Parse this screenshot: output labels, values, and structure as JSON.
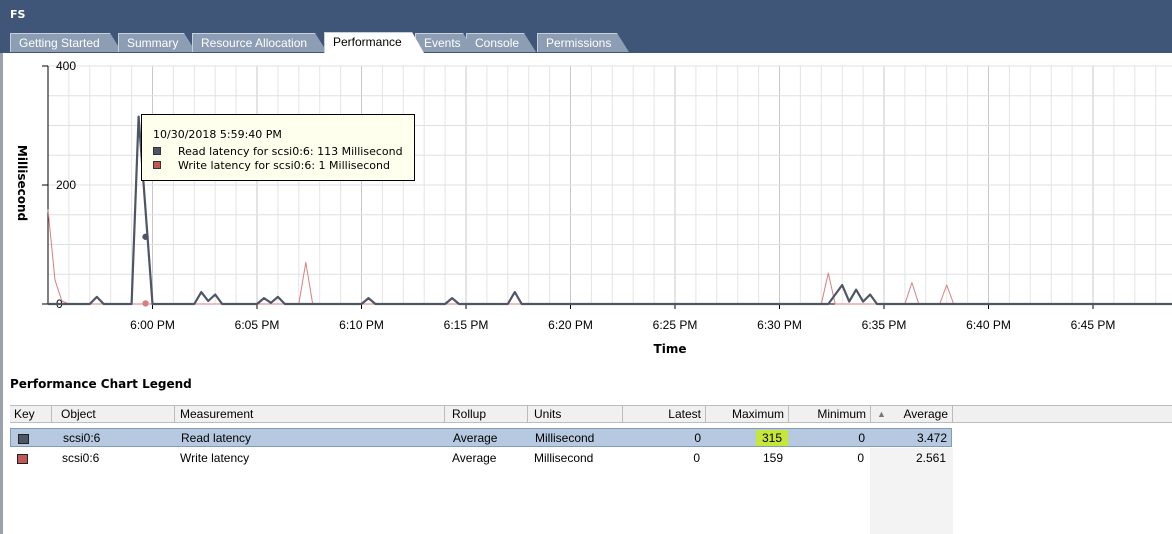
{
  "window": {
    "title": "FS"
  },
  "tabs": [
    {
      "label": "Getting Started",
      "active": false
    },
    {
      "label": "Summary",
      "active": false
    },
    {
      "label": "Resource Allocation",
      "active": false
    },
    {
      "label": "Performance",
      "active": true
    },
    {
      "label": "Events",
      "active": false
    },
    {
      "label": "Console",
      "active": false
    },
    {
      "label": "Permissions",
      "active": false
    }
  ],
  "chart_data": {
    "type": "line",
    "xlabel": "Time",
    "ylabel": "Millisecond",
    "ylim": [
      0,
      400
    ],
    "y_ticks": [
      "400",
      "200",
      "0"
    ],
    "x_tick_labels": [
      "6:00 PM",
      "6:05 PM",
      "6:10 PM",
      "6:15 PM",
      "6:20 PM",
      "6:25 PM",
      "6:30 PM",
      "6:35 PM",
      "6:40 PM",
      "6:45 PM",
      "6"
    ],
    "grid": true,
    "series": [
      {
        "name": "Read latency",
        "color": "#4e5566",
        "x": [
          "5:55 PM",
          "5:57 PM",
          "5:57:20 PM",
          "5:57:40 PM",
          "5:59 PM",
          "5:59:20 PM",
          "6:00 PM",
          "6:02 PM",
          "6:02:20 PM",
          "6:02:40 PM",
          "6:03 PM",
          "6:03:20 PM",
          "6:05 PM",
          "6:05:20 PM",
          "6:05:40 PM",
          "6:06 PM",
          "6:06:20 PM",
          "6:10 PM",
          "6:10:20 PM",
          "6:10:40 PM",
          "6:14 PM",
          "6:14:20 PM",
          "6:14:40 PM",
          "6:17 PM",
          "6:17:20 PM",
          "6:17:40 PM",
          "6:32:20 PM",
          "6:33 PM",
          "6:33:20 PM",
          "6:33:40 PM",
          "6:34 PM",
          "6:34:20 PM",
          "6:34:40 PM",
          "6:35 PM",
          "6:50 PM"
        ],
        "values": [
          0,
          0,
          12,
          0,
          0,
          315,
          0,
          0,
          20,
          5,
          16,
          0,
          0,
          10,
          2,
          12,
          0,
          0,
          10,
          0,
          0,
          10,
          0,
          0,
          20,
          0,
          0,
          32,
          4,
          24,
          4,
          16,
          0,
          0,
          0
        ]
      },
      {
        "name": "Write latency",
        "color": "#d67f7f",
        "x": [
          "5:55 PM",
          "5:55:20 PM",
          "5:55:40 PM",
          "5:56 PM",
          "5:59 PM",
          "6:07 PM",
          "6:07:20 PM",
          "6:07:40 PM",
          "6:32 PM",
          "6:32:20 PM",
          "6:32:40 PM",
          "6:36 PM",
          "6:36:20 PM",
          "6:36:40 PM",
          "6:37:40 PM",
          "6:38 PM",
          "6:38:20 PM",
          "6:50 PM"
        ],
        "values": [
          159,
          40,
          5,
          0,
          0,
          0,
          70,
          0,
          0,
          52,
          0,
          0,
          36,
          0,
          0,
          32,
          0,
          0
        ]
      }
    ],
    "tooltip": {
      "time": "10/30/2018 5:59:40 PM",
      "read": "Read latency for scsi0:6: 113 Millisecond",
      "write": "Write latency for scsi0:6: 1 Millisecond",
      "read_value": 113,
      "write_value": 1
    }
  },
  "legend": {
    "heading": "Performance Chart Legend",
    "columns": [
      "Key",
      "Object",
      "Measurement",
      "Rollup",
      "Units",
      "Latest",
      "Maximum",
      "Minimum",
      "Average"
    ],
    "rows": [
      {
        "key_color": "#4e5566",
        "object": "scsi0:6",
        "measurement": "Read latency",
        "rollup": "Average",
        "units": "Millisecond",
        "latest": "0",
        "maximum": "315",
        "minimum": "0",
        "average": "3.472",
        "selected": true
      },
      {
        "key_color": "#c25757",
        "object": "scsi0:6",
        "measurement": "Write latency",
        "rollup": "Average",
        "units": "Millisecond",
        "latest": "0",
        "maximum": "159",
        "minimum": "0",
        "average": "2.561",
        "selected": false
      }
    ]
  }
}
